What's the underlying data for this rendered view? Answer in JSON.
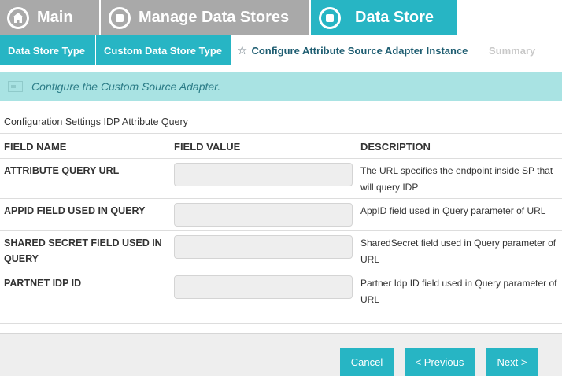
{
  "top_tabs": {
    "main": "Main",
    "manage": "Manage Data Stores",
    "datastore": "Data Store"
  },
  "steps": {
    "step1": "Data Store Type",
    "step2": "Custom Data Store Type",
    "step3": "Configure Attribute Source Adapter Instance",
    "step4": "Summary"
  },
  "banner": {
    "text": "Configure the Custom Source Adapter."
  },
  "section_title": "Configuration Settings IDP Attribute Query",
  "columns": {
    "field_name": "FIELD NAME",
    "field_value": "FIELD VALUE",
    "description": "DESCRIPTION"
  },
  "fields": [
    {
      "name": "ATTRIBUTE QUERY URL",
      "value": "",
      "description": "The URL specifies the endpoint inside SP that will query IDP"
    },
    {
      "name": "APPID FIELD USED IN QUERY",
      "value": "",
      "description": "AppID field used in Query parameter of URL"
    },
    {
      "name": "SHARED SECRET FIELD USED IN QUERY",
      "value": "",
      "description": "SharedSecret field used in Query parameter of URL"
    },
    {
      "name": "PARTNET IDP ID",
      "value": "",
      "description": "Partner Idp ID field used in Query parameter of URL"
    }
  ],
  "buttons": {
    "cancel": "Cancel",
    "previous": "< Previous",
    "next": "Next >"
  },
  "colors": {
    "accent": "#27b5c4",
    "inactive_tab": "#a9a9a9",
    "banner": "#a9e3e3"
  }
}
